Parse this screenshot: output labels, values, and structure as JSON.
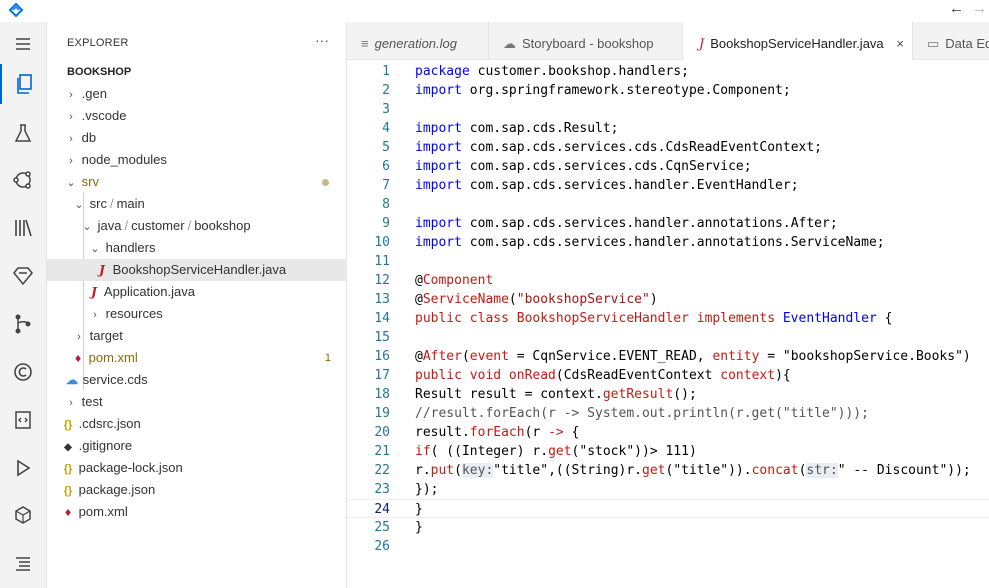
{
  "explorer": {
    "title": "EXPLORER",
    "more": "···",
    "project": "BOOKSHOP",
    "items": [
      {
        "label": ".gen",
        "kind": "folder"
      },
      {
        "label": ".vscode",
        "kind": "folder"
      },
      {
        "label": "db",
        "kind": "folder"
      },
      {
        "label": "node_modules",
        "kind": "folder"
      },
      {
        "label": "srv",
        "kind": "folder-open"
      },
      {
        "label": "src",
        "kind": "folder-open",
        "sep": "/",
        "label2": "main"
      },
      {
        "label": "java",
        "kind": "folder-open",
        "sep": "/",
        "label2": "customer",
        "sep2": "/",
        "label3": "bookshop"
      },
      {
        "label": "handlers",
        "kind": "folder-open"
      },
      {
        "label": "BookshopServiceHandler.java",
        "kind": "java"
      },
      {
        "label": "Application.java",
        "kind": "java"
      },
      {
        "label": "resources",
        "kind": "folder"
      },
      {
        "label": "target",
        "kind": "folder"
      },
      {
        "label": "pom.xml",
        "kind": "maven",
        "badge": "1"
      },
      {
        "label": "service.cds",
        "kind": "cds"
      },
      {
        "label": "test",
        "kind": "folder"
      },
      {
        "label": ".cdsrc.json",
        "kind": "json"
      },
      {
        "label": ".gitignore",
        "kind": "git"
      },
      {
        "label": "package-lock.json",
        "kind": "json"
      },
      {
        "label": "package.json",
        "kind": "json"
      },
      {
        "label": "pom.xml",
        "kind": "maven"
      }
    ]
  },
  "tabs": [
    {
      "label": "generation.log",
      "icon": "lines-icon"
    },
    {
      "label": "Storyboard - bookshop",
      "icon": "cloud-icon"
    },
    {
      "label": "BookshopServiceHandler.java",
      "icon": "java-icon",
      "close": "×"
    },
    {
      "label": "Data Ed",
      "icon": "page-icon"
    }
  ],
  "editor": {
    "line_numbers": [
      "1",
      "2",
      "3",
      "4",
      "5",
      "6",
      "7",
      "8",
      "9",
      "10",
      "11",
      "12",
      "13",
      "14",
      "15",
      "16",
      "17",
      "18",
      "19",
      "20",
      "21",
      "22",
      "23",
      "24",
      "25",
      "26"
    ],
    "code": {
      "l1a": "package",
      "l1b": " customer.bookshop.handlers;",
      "l2a": "import",
      "l2b": " org.springframework.stereotype.Component;",
      "l4a": "import",
      "l4b": " com.sap.cds.Result;",
      "l5a": "import",
      "l5b": " com.sap.cds.services.cds.CdsReadEventContext;",
      "l6a": "import",
      "l6b": " com.sap.cds.services.cds.CqnService;",
      "l7a": "import",
      "l7b": " com.sap.cds.services.handler.EventHandler;",
      "l9a": "import",
      "l9b": " com.sap.cds.services.handler.annotations.After;",
      "l10a": "import",
      "l10b": " com.sap.cds.services.handler.annotations.ServiceName;",
      "l12a": "@",
      "l12b": "Component",
      "l13a": "@",
      "l13b": "ServiceName",
      "l13c": "(",
      "l13d": "\"bookshopService\"",
      "l13e": ")",
      "l14a": "public class ",
      "l14b": "BookshopServiceHandler",
      "l14c": " implements ",
      "l14d": "EventHandler",
      "l14e": " {",
      "l16a": "@",
      "l16b": "After",
      "l16c": "(",
      "l16d": "event",
      "l16e": " = CqnService.EVENT_READ, ",
      "l16f": "entity",
      "l16g": " = ",
      "l16h": "\"bookshopService.Books\"",
      "l16i": ")",
      "l17a": "public void ",
      "l17b": "onRead",
      "l17c": "(CdsReadEventContext ",
      "l17d": "context",
      "l17e": "){",
      "l18a": "Result result = context.",
      "l18b": "getResult",
      "l18c": "();",
      "l19": "//result.forEach(r -> System.out.println(r.get(\"title\")));",
      "l20a": "result.",
      "l20b": "forEach",
      "l20c": "(r ",
      "l20d": "->",
      "l20e": " {",
      "l21a": "if",
      "l21b": "( ((Integer) r.",
      "l21c": "get",
      "l21d": "(",
      "l21e": "\"stock\"",
      "l21f": "))> ",
      "l21g": "111",
      "l21h": ")",
      "l22a": "r.",
      "l22b": "put",
      "l22c": "(",
      "l22d": "key:",
      "l22e": "\"title\"",
      "l22f": ",((String)r.",
      "l22g": "get",
      "l22h": "(",
      "l22i": "\"title\"",
      "l22j": ")).",
      "l22k": "concat",
      "l22l": "(",
      "l22m": "str:",
      "l22n": "\" -- Discount\"",
      "l22o": "));",
      "l23": "});",
      "l24": "}",
      "l25": "}"
    }
  },
  "colors": {
    "keyword": "#0000ff",
    "annotation": "#c41a16",
    "string": "#a31515",
    "type": "#267f99",
    "function": "#795e26",
    "comment": "#008000",
    "line_number": "#237893",
    "accent": "#0064d9"
  }
}
